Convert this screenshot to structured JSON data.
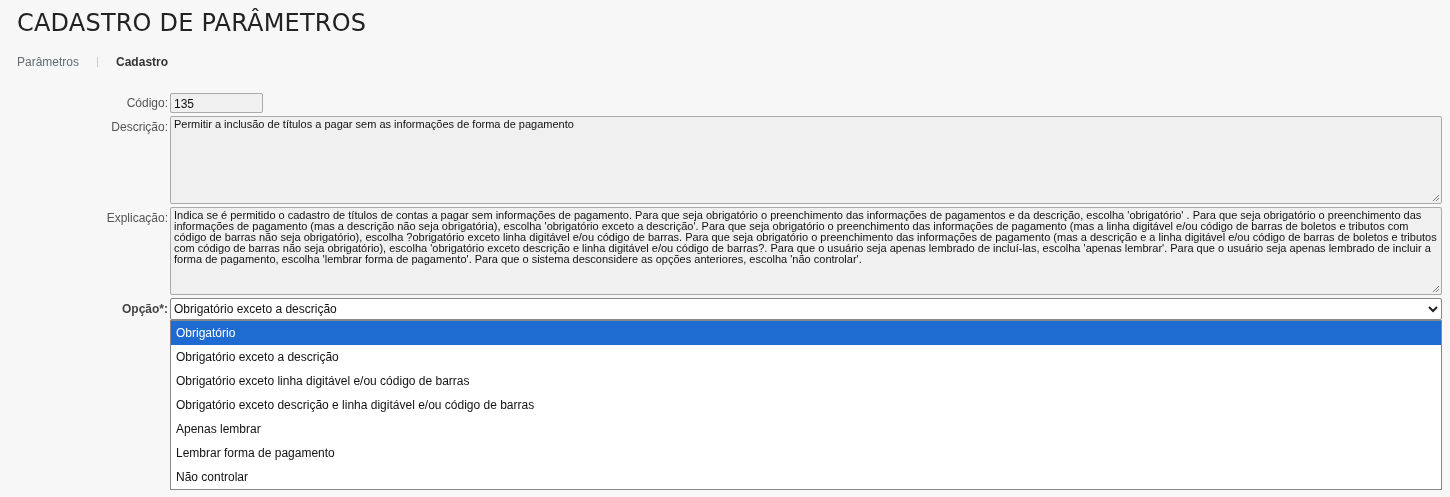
{
  "page": {
    "title": "CADASTRO DE PARÂMETROS"
  },
  "breadcrumb": [
    {
      "label": "Parâmetros",
      "selected": false
    },
    {
      "label": "Cadastro",
      "selected": true
    }
  ],
  "form": {
    "fields": [
      {
        "kind": "text",
        "label": "Código:",
        "value": "135"
      },
      {
        "kind": "textarea",
        "label": "Descrição:",
        "value": "Permitir a inclusão de títulos a pagar sem as informações de forma de pagamento"
      },
      {
        "kind": "textarea",
        "label": "Explicação:",
        "value": "Indica se é permitido o cadastro de títulos de contas a pagar sem informações de pagamento. Para que seja obrigatório o preenchimento das informações de pagamentos e da descrição, escolha 'obrigatório' . Para que seja obrigatório o preenchimento das informações de pagamento (mas a descrição não seja obrigatória), escolha 'obrigatório exceto a descrição'. Para que seja obrigatório o preenchimento das informações de pagamento (mas a linha digitável e/ou código de barras de boletos e tributos com código de barras não seja obrigatório), escolha ?obrigatório exceto linha digitável e/ou código de barras. Para que seja obrigatório o preenchimento das informações de pagamento (mas a descrição e a linha digitável e/ou código de barras de boletos e tributos com código de barras não seja obrigatório), escolha 'obrigatório exceto descrição e linha digitável e/ou código de barras?. Para que o usuário seja apenas lembrado de incluí-las, escolha 'apenas lembrar'. Para que o usuário seja apenas lembrado de incluir a forma de pagamento, escolha 'lembrar forma de pagamento'. Para que o sistema desconsidere as opções anteriores, escolha 'não controlar'."
      },
      {
        "kind": "select",
        "label": "Opção*:",
        "value": "Obrigatório exceto a descrição",
        "expanded": true,
        "options": [
          {
            "label": "Obrigatório",
            "highlighted": true
          },
          {
            "label": "Obrigatório exceto a descrição",
            "highlighted": false
          },
          {
            "label": "Obrigatório exceto linha digitável e/ou código de barras",
            "highlighted": false
          },
          {
            "label": "Obrigatório exceto descrição e linha digitável e/ou código de barras",
            "highlighted": false
          },
          {
            "label": "Apenas lembrar",
            "highlighted": false
          },
          {
            "label": "Lembrar forma de pagamento",
            "highlighted": false
          },
          {
            "label": "Não controlar",
            "highlighted": false
          }
        ]
      }
    ]
  }
}
